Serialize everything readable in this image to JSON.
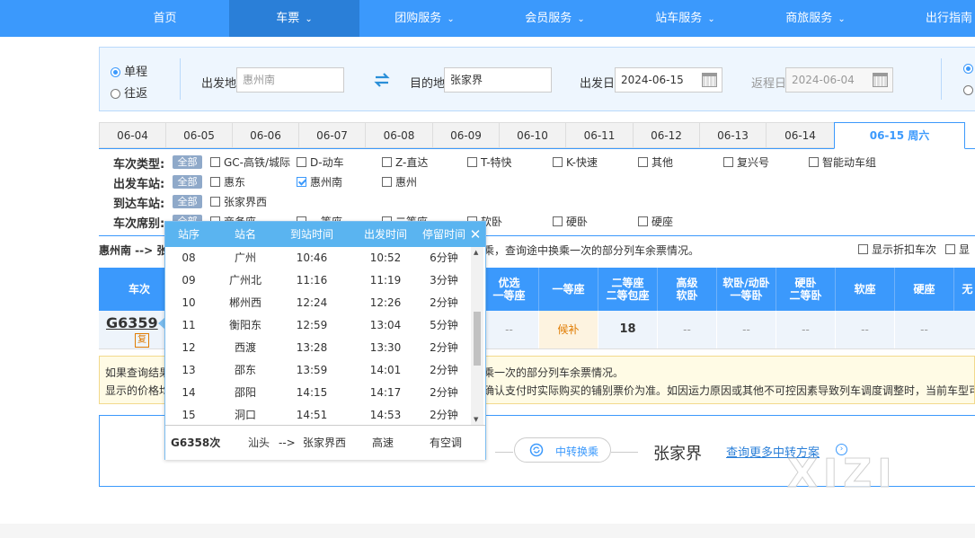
{
  "nav": {
    "items": [
      {
        "label": "首页",
        "chev": false
      },
      {
        "label": "车票",
        "chev": true,
        "active": true
      },
      {
        "label": "团购服务",
        "chev": true
      },
      {
        "label": "会员服务",
        "chev": true
      },
      {
        "label": "站车服务",
        "chev": true
      },
      {
        "label": "商旅服务",
        "chev": true
      },
      {
        "label": "出行指南",
        "chev": false
      }
    ]
  },
  "query": {
    "oneway_label": "单程",
    "roundtrip_label": "往返",
    "from_label": "出发地",
    "from_value": "惠州南",
    "to_label": "目的地",
    "to_value": "张家界",
    "depart_label": "出发日",
    "depart_value": "2024-06-15",
    "return_label": "返程日",
    "return_value": "2024-06-04"
  },
  "dates": [
    "06-04",
    "06-05",
    "06-06",
    "06-07",
    "06-08",
    "06-09",
    "06-10",
    "06-11",
    "06-12",
    "06-13",
    "06-14",
    "06-15 周六"
  ],
  "filters": {
    "type_label": "车次类型:",
    "from_label": "出发车站:",
    "to_label": "到达车站:",
    "seat_label": "车次席别:",
    "all": "全部",
    "types": [
      "GC-高铁/城际",
      "D-动车",
      "Z-直达",
      "T-特快",
      "K-快速",
      "其他",
      "复兴号",
      "智能动车组"
    ],
    "from_stations": [
      "惠东",
      "惠州南",
      "惠州"
    ],
    "to_stations": [
      "张家界西"
    ],
    "seats": [
      "商务座",
      "一等座",
      "二等座",
      "软卧",
      "硬卧",
      "硬座"
    ]
  },
  "route_text": "惠州南 --> 张",
  "route_hint": "乘，查询途中换乘一次的部分列车余票情况。",
  "discount_label": "显示折扣车次",
  "discount_label2": "显",
  "table": {
    "headers": [
      "车次",
      "优选\n一等座",
      "一等座",
      "二等座\n二等包座",
      "高级\n软卧",
      "软卧/动卧\n一等卧",
      "硬卧\n二等卧",
      "软座",
      "硬座",
      "无"
    ],
    "row": {
      "train": "G6359",
      "badge": "复",
      "cells": [
        "--",
        "候补",
        "18",
        "--",
        "--",
        "--",
        "--",
        "--"
      ]
    }
  },
  "note": {
    "line1_start": "如果查询结果",
    "line1_end": "乘一次的部分列车余票情况。",
    "line2_start": "显示的价格均",
    "line2_end": "确认支付时实际购买的铺别票价为准。如因运力原因或其他不可控因素导致列车调度调整时，当前车型可"
  },
  "transfer": {
    "button": "中转换乘",
    "destination": "张家界",
    "more_link": "查询更多中转方案"
  },
  "popup": {
    "headers": [
      "站序",
      "站名",
      "到站时间",
      "出发时间",
      "停留时间"
    ],
    "rows": [
      [
        "08",
        "广州",
        "10:46",
        "10:52",
        "6分钟"
      ],
      [
        "09",
        "广州北",
        "11:16",
        "11:19",
        "3分钟"
      ],
      [
        "10",
        "郴州西",
        "12:24",
        "12:26",
        "2分钟"
      ],
      [
        "11",
        "衡阳东",
        "12:59",
        "13:04",
        "5分钟"
      ],
      [
        "12",
        "西渡",
        "13:28",
        "13:30",
        "2分钟"
      ],
      [
        "13",
        "邵东",
        "13:59",
        "14:01",
        "2分钟"
      ],
      [
        "14",
        "邵阳",
        "14:15",
        "14:17",
        "2分钟"
      ],
      [
        "15",
        "洞口",
        "14:51",
        "14:53",
        "2分钟"
      ]
    ],
    "footer": {
      "train": "G6358次",
      "from": "汕头",
      "arrow": "-->",
      "to": "张家界西",
      "category": "高速",
      "ac": "有空调"
    }
  },
  "watermark": "XIZI",
  "colors": {
    "primary": "#3b99fc",
    "nav_active": "#2a7fd8",
    "popup_header": "#5ab4f0",
    "waitlist": "#e07b00"
  }
}
